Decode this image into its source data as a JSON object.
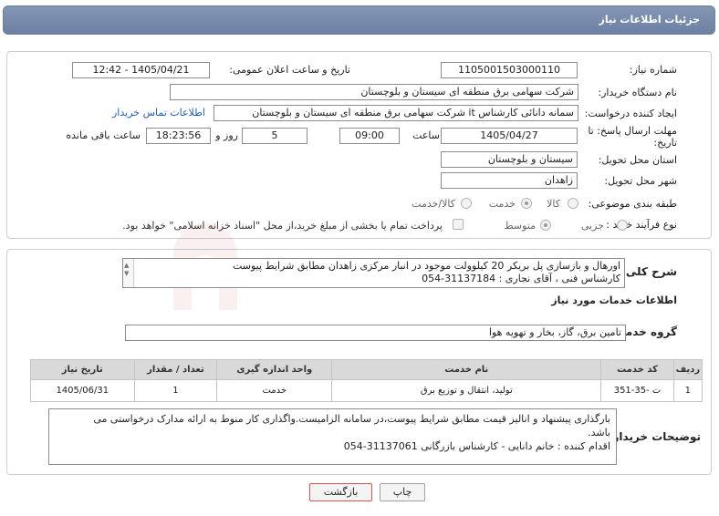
{
  "header": {
    "title": "جزئیات اطلاعات نیاز"
  },
  "fields": {
    "need_number_label": "شماره نیاز:",
    "need_number": "1105001503000110",
    "announce_label": "تاریخ و ساعت اعلان عمومی:",
    "announce_value": "1405/04/21 - 12:42",
    "buyer_org_label": "نام دستگاه خریدار:",
    "buyer_org": "شرکت سهامی برق منطقه ای سیستان و بلوچستان",
    "requester_label": "ایجاد کننده درخواست:",
    "requester": "سمانه دانائی کارشناس it شرکت سهامی برق منطقه ای سیستان و بلوچستان",
    "contact_link": "اطلاعات تماس خریدار",
    "deadline_label_1": "مهلت ارسال پاسخ: تا",
    "deadline_label_2": "تاریخ:",
    "deadline_date": "1405/04/27",
    "time_label": "ساعت",
    "deadline_time": "09:00",
    "days_value": "5",
    "days_label": "روز و",
    "remaining_time": "18:23:56",
    "remaining_label": "ساعت باقی مانده",
    "province_label": "استان محل تحویل:",
    "province": "سیستان و بلوچستان",
    "city_label": "شهر محل تحویل:",
    "city": "زاهدان",
    "category_label": "طبقه بندی موضوعی:",
    "category_options": [
      "کالا",
      "خدمت",
      "کالا/خدمت"
    ],
    "purchase_type_label": "نوع فرآیند خرید :",
    "purchase_options": [
      "جزیی",
      "متوسط"
    ],
    "payment_note": "پرداخت تمام یا بخشی از مبلغ خرید،از محل \"اسناد خزانه اسلامی\" خواهد بود."
  },
  "summary": {
    "label": "شرح کلی نیاز:",
    "line1": "اورهال و بازسازی پل بریکر 20 کیلوولت موجود در انبار مرکزی زاهدان مطابق شرایط پیوست",
    "line2": "کارشناس فنی ، آقای نجاری : 31137184-054"
  },
  "services": {
    "section_title": "اطلاعات خدمات مورد نیاز",
    "group_label": "گروه خدمت:",
    "group_value": "تامین برق، گاز، بخار و تهویه هوا",
    "columns": [
      "ردیف",
      "کد خدمت",
      "نام خدمت",
      "واحد اندازه گیری",
      "تعداد / مقدار",
      "تاریخ نیاز"
    ],
    "rows": [
      {
        "row": "1",
        "code": "ت -35-351",
        "name": "تولید، انتقال و توزیع برق",
        "unit": "خدمت",
        "qty": "1",
        "date": "1405/06/31"
      }
    ]
  },
  "buyer_notes": {
    "label": "توضیحات خریدار:",
    "line1": "بارگذاری پیشنهاد و انالیز قیمت مطابق شرایط پیوست،در سامانه الزامیست.واگذاری کار منوط به ارائه مدارک درخواستی می",
    "line2": "باشد.",
    "line3": "اقدام کننده : خانم دانایی - کارشناس بازرگانی 31137061-054"
  },
  "buttons": {
    "print": "چاپ",
    "back": "بازگشت"
  },
  "colors": {
    "header": "#7288aa",
    "link": "#1f5fbf",
    "back_button_border": "#d9534f"
  }
}
